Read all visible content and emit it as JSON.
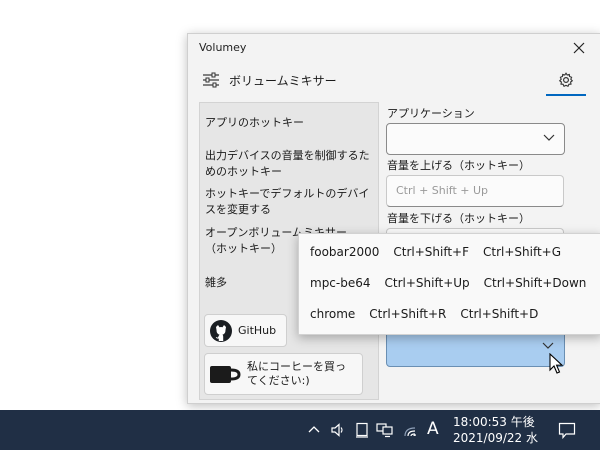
{
  "window": {
    "title": "Volumey",
    "header_title": "ボリュームミキサー"
  },
  "sidebar": {
    "items": [
      {
        "label": "アプリのホットキー"
      },
      {
        "label": "出力デバイスの音量を制御するためのホットキー"
      },
      {
        "label": "ホットキーでデフォルトのデバイスを変更する"
      },
      {
        "label": "オープンボリュームミキサー （ホットキー）"
      },
      {
        "label": "雑多"
      }
    ],
    "github_label": "GitHub",
    "coffee_label": "私にコーヒーを買ってください:)"
  },
  "content": {
    "app_label": "アプリケーション",
    "volume_up_label": "音量を上げる（ホットキー）",
    "volume_up_placeholder": "Ctrl + Shift + Up",
    "volume_down_label": "音量を下げる（ホットキー）"
  },
  "popup": {
    "rows": [
      {
        "app": "foobar2000",
        "up": "Ctrl+Shift+F",
        "down": "Ctrl+Shift+G"
      },
      {
        "app": "mpc-be64",
        "up": "Ctrl+Shift+Up",
        "down": "Ctrl+Shift+Down"
      },
      {
        "app": "chrome",
        "up": "Ctrl+Shift+R",
        "down": "Ctrl+Shift+D"
      }
    ]
  },
  "taskbar": {
    "ime_mode": "A",
    "time": "18:00:53 午後",
    "date": "2021/09/22 水"
  },
  "colors": {
    "accent": "#0067c0",
    "taskbar": "#202f45",
    "selected_combo": "#a9cdf0"
  },
  "icons": [
    "close-icon",
    "mixer-icon",
    "gear-icon",
    "chevron-down-icon",
    "github-icon",
    "coffee-icon",
    "speaker-icon",
    "network-icon",
    "notification-icon"
  ]
}
